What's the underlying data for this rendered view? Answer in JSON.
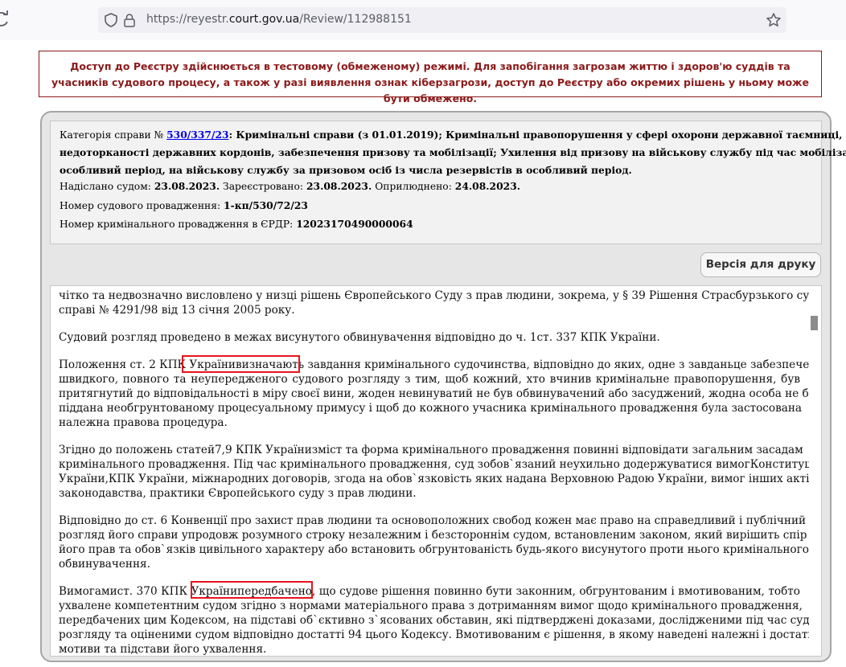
{
  "browser": {
    "url_prefix": "https://reyestr.",
    "url_host": "court.gov.ua",
    "url_path": "/Review/112988151"
  },
  "notice": {
    "text": "Доступ до Реєстру здійснюється в тестовому (обмеженому) режимі. Для запобігання загрозам життю і здоров'ю суддів та учасників судового процесу, а також у разі виявлення ознак кіберзагрози, доступ до Реєстру або окремих рішень у ньому може бути обмежено."
  },
  "case_info": {
    "category_prefix": "Категорія справи №",
    "case_number": "530/337/23",
    "category_line1": ": Кримінальні справи (з 01.01.2019); Кримінальні правопорушення у сфері охорони державної таємниці,",
    "category_line2": "недоторканості державних кордонів, забезпечення призову та мобілізації; Ухилення від призову на військову службу під час мобілізації, на",
    "category_line3": "особливий період, на військову службу за призовом осіб із числа резервістів в особливий період.",
    "sent_label": "Надіслано судом:",
    "sent_date": "23.08.2023.",
    "registered_label": "Зареєстровано:",
    "registered_date": "23.08.2023.",
    "published_label": "Оприлюднено:",
    "published_date": "24.08.2023.",
    "court_proc_label": "Номер судового провадження:",
    "court_proc_number": "1-кп/530/72/23",
    "criminal_proc_label": "Номер кримінального провадження в ЄРДР:",
    "criminal_proc_number": "12023170490000064"
  },
  "print_button": {
    "label": "Версія для друку"
  },
  "document": {
    "lines": [
      "чітко та недвозначно висловлено у низці рішень Європейського Суду з прав людини, зокрема, у § 39 Рішення Страсбурзького суду у",
      "справі № 4291/98 від 13 січня 2005 року.",
      "Судовий розгляд проведено в межах висунутого обвинувачення відповідно до ч. 1ст. 337 КПК України.",
      "Положення ст. 2 КПК Українивизначають завдання кримінального судочинства, відповідно до яких, одне з завданьце забезпечення",
      "швидкого, повного та неупередженого судового розгляду з тим, щоб кожний, хто вчинив кримінальне правопорушення, був",
      "притягнутий до відповідальності в міру своєї вини, жоден невинуватий не був обвинувачений або засуджений, жодна особа не була",
      "піддана необгрунтованому процесуальному примусу і щоб до кожного учасника кримінального провадження була застосована",
      "належна правова процедура.",
      "Згідно до положень статей7,9 КПК Українизміст та форма кримінального провадження повинні відповідати загальним засадам",
      "кримінального провадження. Під час кримінального провадження, суд зобов`язаний неухильно додержуватися вимогКонституції",
      "України,КПК України, міжнародних договорів, згода на обов`язковість яких надана Верховною Радою України, вимог інших актів",
      "законодавства, практики Європейського суду з прав людини.",
      "Відповідно до ст. 6 Конвенції про захист прав людини та основоположних свобод кожен має право на справедливий і публічний",
      "розгляд його справи упродовж розумного строку незалежним і безстороннім судом, встановленим законом, який вирішить спір щодо",
      "його прав та обов`язків цивільного характеру або встановить обгрунтованість будь-якого висунутого проти нього кримінального",
      "обвинувачення.",
      "Вимогамист. 370 КПК Українипередбачено, що судове рішення повинно бути законним, обгрунтованим і вмотивованим, тобто",
      "ухвалене компетентним судом згідно з нормами матеріального права з дотриманням вимог щодо кримінального провадження,",
      "передбачених цим Кодексом, на підставі об`єктивно з`ясованих обставин, які підтверджені доказами, дослідженими під час судового",
      "розгляду та оціненими судом відповідно достатті 94 цього Кодексу. Вмотивованим є рішення, в якому наведені належні і достатні",
      "мотиви та підстави його ухвалення."
    ],
    "highlights": [
      "Українивизначають",
      "Українипередбачено,"
    ]
  }
}
